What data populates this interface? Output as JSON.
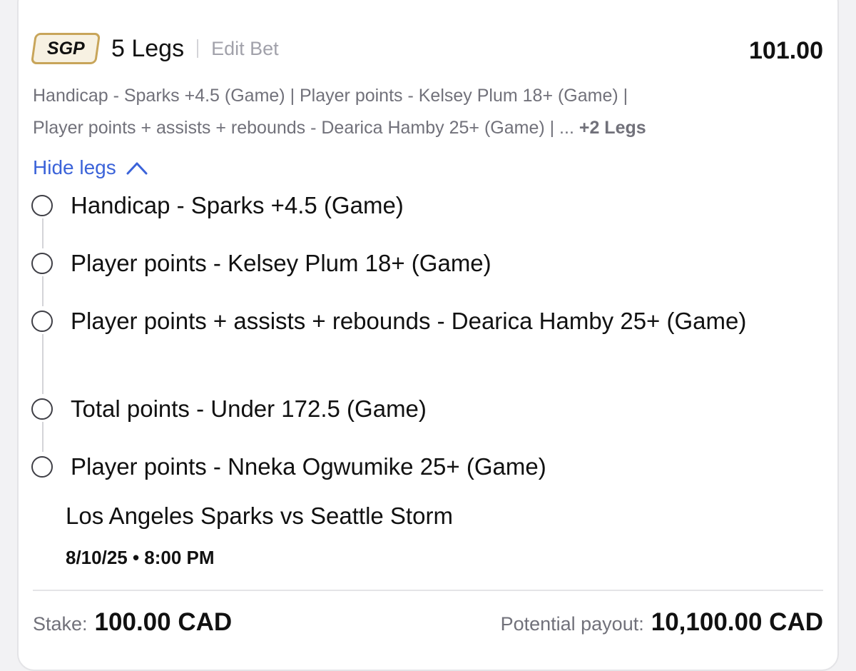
{
  "header": {
    "badge": "SGP",
    "legs_count": "5 Legs",
    "edit_label": "Edit Bet",
    "odds": "101.00"
  },
  "summary": {
    "line1": "Handicap - Sparks +4.5 (Game) | Player points - Kelsey Plum 18+ (Game) |",
    "line2": "Player points + assists + rebounds - Dearica Hamby 25+ (Game) | ... ",
    "more": "+2 Legs"
  },
  "toggle": {
    "label": "Hide legs"
  },
  "legs": [
    {
      "label": "Handicap - Sparks +4.5 (Game)"
    },
    {
      "label": "Player points - Kelsey Plum 18+ (Game)"
    },
    {
      "label": "Player points + assists + rebounds - Dearica Hamby 25+ (Game)"
    },
    {
      "label": "Total points - Under 172.5 (Game)"
    },
    {
      "label": "Player points - Nneka Ogwumike 25+ (Game)"
    }
  ],
  "event": {
    "matchup": "Los Angeles Sparks vs Seattle Storm",
    "datetime": "8/10/25 • 8:00 PM"
  },
  "footer": {
    "stake_label": "Stake:",
    "stake_value": "100.00 CAD",
    "payout_label": "Potential payout:",
    "payout_value": "10,100.00 CAD"
  },
  "colors": {
    "accent_link": "#3b63d9",
    "badge_border": "#c8a55a",
    "muted_text": "#71717a"
  }
}
